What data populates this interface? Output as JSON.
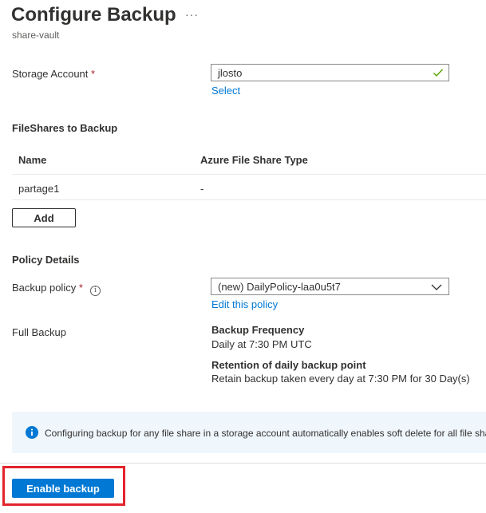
{
  "header": {
    "title": "Configure Backup",
    "more_label": "···",
    "subtitle": "share-vault"
  },
  "storage": {
    "label": "Storage Account",
    "required_mark": "*",
    "value": "jlosto",
    "select_link": "Select"
  },
  "fileshares": {
    "title": "FileShares to Backup",
    "columns": [
      "Name",
      "Azure File Share Type"
    ],
    "rows": [
      {
        "name": "partage1",
        "type": "-"
      }
    ],
    "add_label": "Add"
  },
  "policy": {
    "title": "Policy Details",
    "backup_policy_label": "Backup policy",
    "required_mark": "*",
    "info_glyph": "i",
    "selected": "(new) DailyPolicy-laa0u5t7",
    "edit_link": "Edit this policy",
    "full_backup_label": "Full Backup",
    "frequency_title": "Backup Frequency",
    "frequency_value": "Daily at 7:30 PM UTC",
    "retention_title": "Retention of daily backup point",
    "retention_value": "Retain backup taken every day at 7:30 PM for 30 Day(s)"
  },
  "banner": {
    "message": "Configuring backup for any file share in a storage account automatically enables soft delete for all file shares in the storage account."
  },
  "footer": {
    "enable_label": "Enable backup"
  },
  "colors": {
    "accent": "#0078d4",
    "required": "#a4262c",
    "valid": "#57a300",
    "highlight": "#e3242b",
    "banner_bg": "#eff6fc"
  }
}
